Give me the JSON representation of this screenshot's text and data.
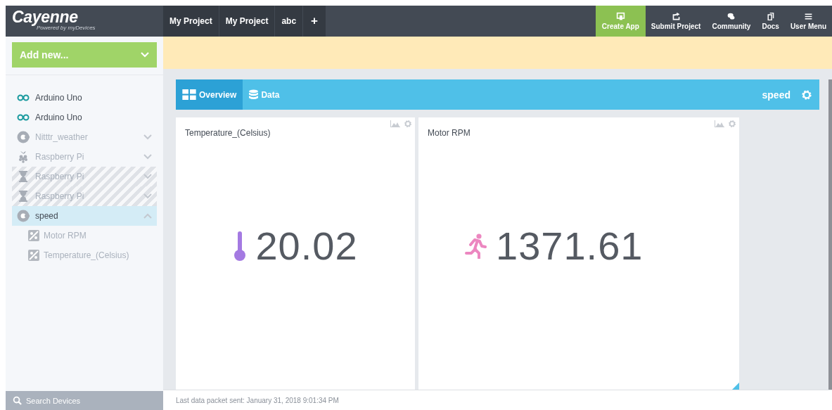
{
  "header": {
    "logo": "Cayenne",
    "tagline": "Powered by myDevices",
    "project_tabs": [
      "My Project",
      "My Project",
      "abc",
      "+"
    ],
    "nav": [
      {
        "label": "Create App",
        "kind": "app",
        "highlighted": true
      },
      {
        "label": "Submit Project",
        "kind": "share",
        "highlighted": false
      },
      {
        "label": "Community",
        "kind": "chat",
        "highlighted": false
      },
      {
        "label": "Docs",
        "kind": "docs",
        "highlighted": false
      },
      {
        "label": "User Menu",
        "kind": "menu",
        "highlighted": false
      }
    ]
  },
  "sidebar": {
    "add_button": "Add new...",
    "devices": [
      {
        "name": "Arduino Uno",
        "kind": "arduino",
        "dimmed": false,
        "pending": false,
        "selected": false
      },
      {
        "name": "Arduino Uno",
        "kind": "arduino",
        "dimmed": false,
        "pending": false,
        "selected": false
      },
      {
        "name": "Nitttr_weather",
        "kind": "cayenne",
        "dimmed": true,
        "pending": false,
        "selected": false,
        "expanded": false
      },
      {
        "name": "Raspberry Pi",
        "kind": "raspberry",
        "dimmed": true,
        "pending": false,
        "selected": false,
        "expanded": false
      },
      {
        "name": "Raspberry Pi",
        "kind": "hourglass",
        "dimmed": true,
        "pending": true,
        "selected": false,
        "expanded": false
      },
      {
        "name": "Raspberry Pi",
        "kind": "hourglass",
        "dimmed": true,
        "pending": true,
        "selected": false,
        "expanded": false
      },
      {
        "name": "speed",
        "kind": "cayenne",
        "dimmed": false,
        "pending": false,
        "selected": true,
        "expanded": true,
        "children": [
          {
            "name": "Motor RPM"
          },
          {
            "name": "Temperature_(Celsius)"
          }
        ]
      }
    ],
    "search": {
      "placeholder": "Search Devices"
    }
  },
  "dashboard": {
    "tabs": [
      {
        "label": "Overview",
        "kind": "grid",
        "selected": true
      },
      {
        "label": "Data",
        "kind": "database",
        "selected": false
      }
    ],
    "device_title": "speed",
    "widgets": [
      {
        "title": "Temperature_(Celsius)",
        "kind": "thermometer",
        "color": "#a47ae2",
        "value": "20.02"
      },
      {
        "title": "Motor RPM",
        "kind": "runner",
        "color": "#ec87c0",
        "value": "1371.61"
      }
    ]
  },
  "status_bar": "Last data packet sent: January 31, 2018 9:01:34 PM"
}
